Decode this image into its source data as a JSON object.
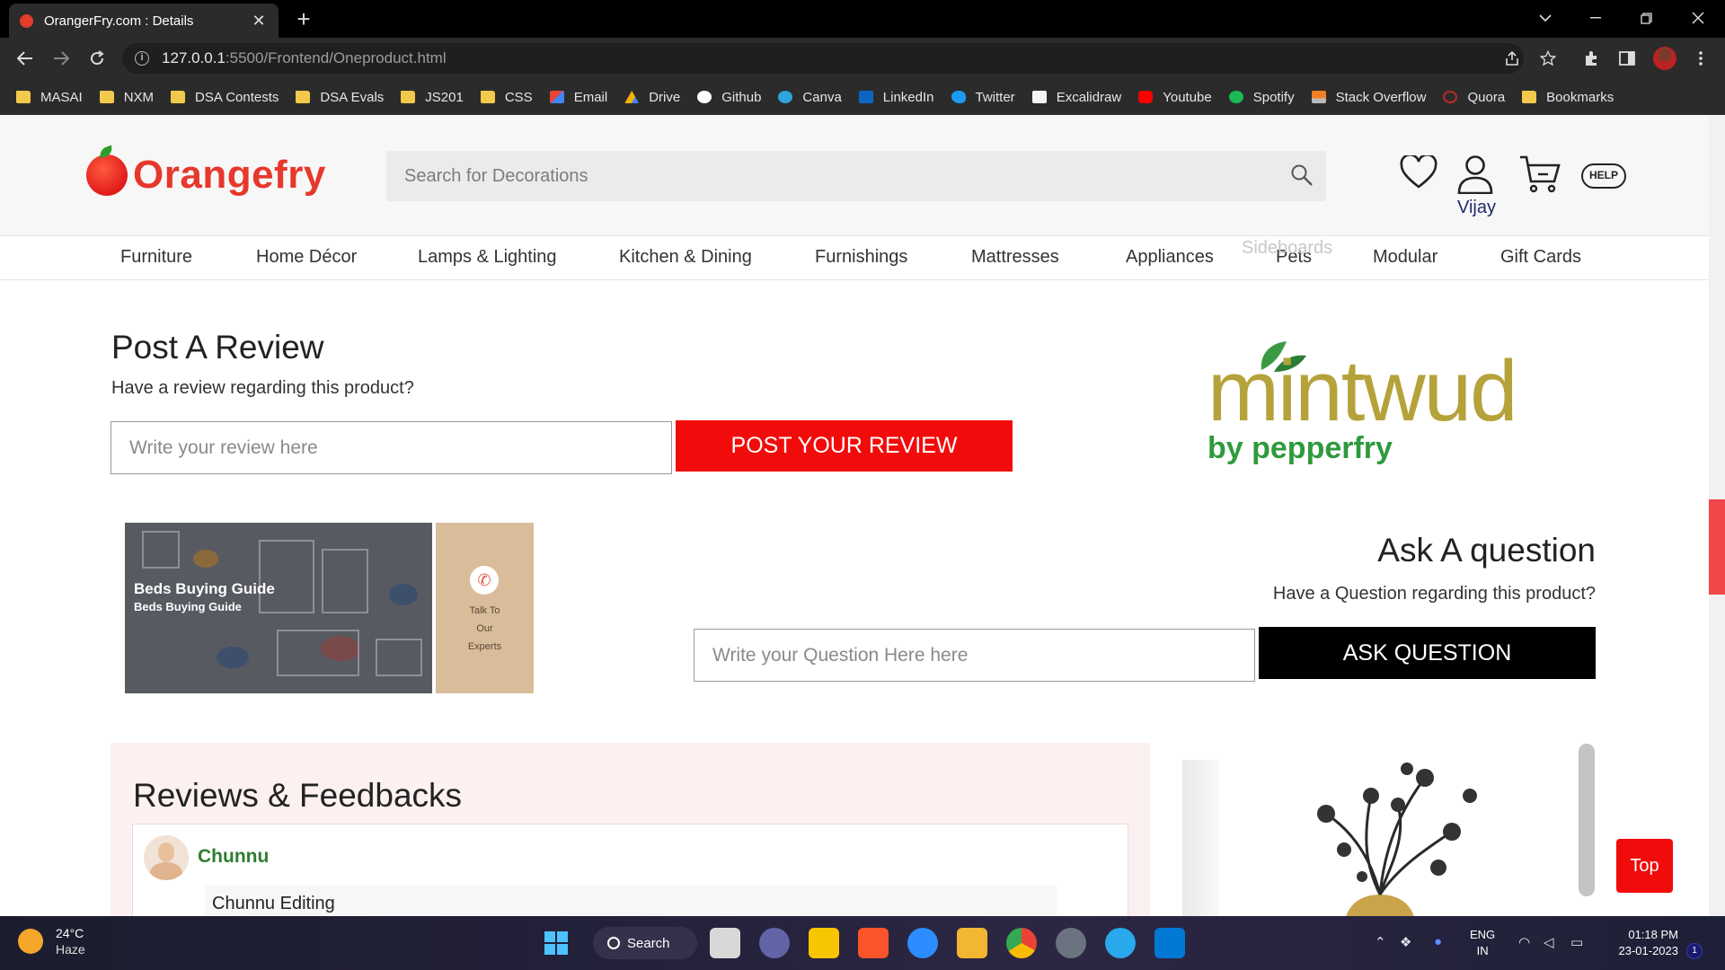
{
  "browser": {
    "tab_title": "OrangerFry.com : Details",
    "tab_close": "✕",
    "new_tab": "+",
    "url_host": "127.0.0.1",
    "url_path": ":5500/Frontend/Oneproduct.html",
    "bookmarks": [
      "MASAI",
      "NXM",
      "DSA Contests",
      "DSA Evals",
      "JS201",
      "CSS",
      "Email",
      "Drive",
      "Github",
      "Canva",
      "LinkedIn",
      "Twitter",
      "Excalidraw",
      "Youtube",
      "Spotify",
      "Stack Overflow",
      "Quora",
      "Bookmarks"
    ]
  },
  "header": {
    "logo_text": "Orangefry",
    "search_placeholder": "Search for Decorations",
    "user_name": "Vijay",
    "help_label": "HELP"
  },
  "categories": [
    "Furniture",
    "Home Décor",
    "Lamps & Lighting",
    "Kitchen & Dining",
    "Furnishings",
    "Mattresses",
    "Appliances",
    "Pets",
    "Modular",
    "Gift Cards"
  ],
  "hover_label": "Sideboards",
  "review": {
    "title": "Post A Review",
    "subtitle": "Have a review regarding this product?",
    "placeholder": "Write your review here",
    "button": "POST YOUR REVIEW"
  },
  "brand": {
    "name": "mintwud",
    "tagline": "by pepperfry"
  },
  "guide": {
    "title": "Beds Buying Guide",
    "subtitle": "Beds Buying Guide",
    "expert_lines": [
      "Talk To",
      "Our",
      "Experts"
    ]
  },
  "question": {
    "title": "Ask A question",
    "subtitle": "Have a Question regarding this product?",
    "placeholder": "Write your Question Here here",
    "button": "ASK QUESTION"
  },
  "reviews": {
    "title": "Reviews & Feedbacks",
    "items": [
      {
        "name": "Chunnu",
        "text": "Chunnu Editing"
      }
    ]
  },
  "top_button": "Top",
  "taskbar": {
    "temperature": "24°C",
    "condition": "Haze",
    "search_label": "Search",
    "lang_line1": "ENG",
    "lang_line2": "IN",
    "time": "01:18 PM",
    "date": "23-01-2023",
    "notification_count": "1"
  },
  "colors": {
    "brand_red": "#e8372b",
    "post_button": "#f20b0b",
    "ask_button": "#000000",
    "reviewer_name": "#2e7d32",
    "mintwud_gold": "#b5a23a",
    "pepperfry_green": "#2f9a3d"
  }
}
